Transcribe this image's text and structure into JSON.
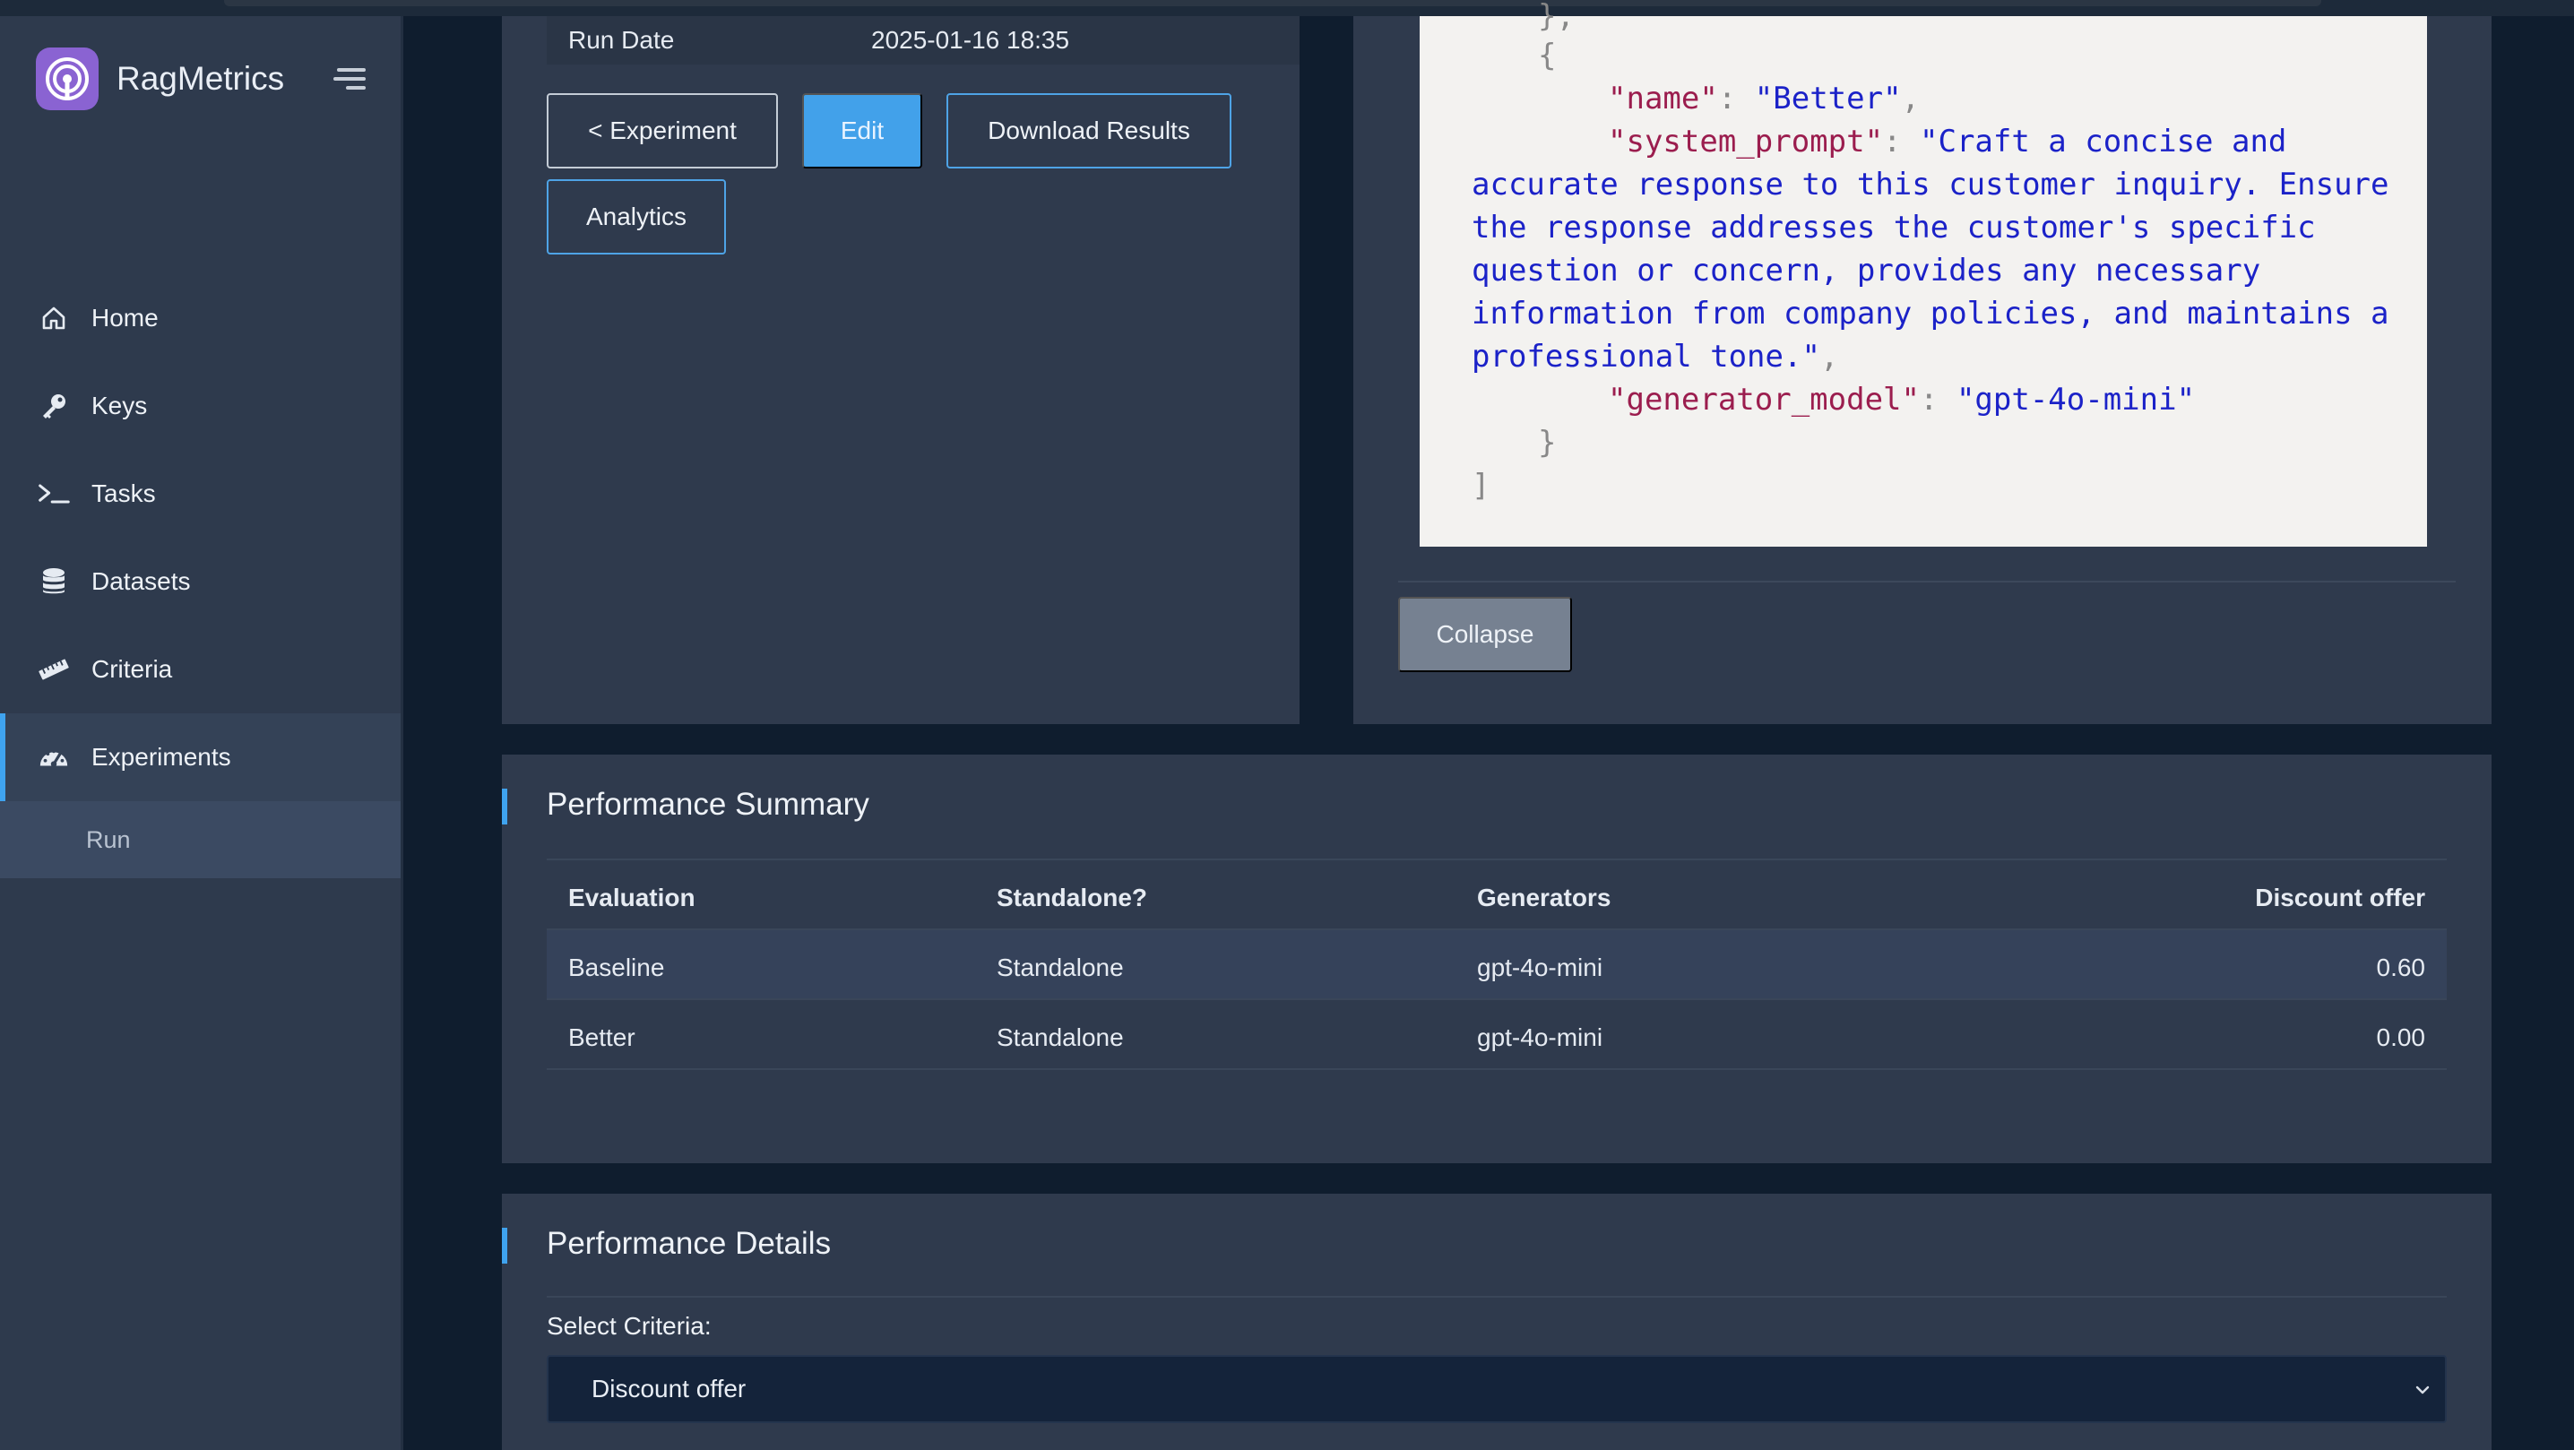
{
  "app": {
    "name": "RagMetrics"
  },
  "sidebar": {
    "items": [
      {
        "label": "Home",
        "icon": "home-icon"
      },
      {
        "label": "Keys",
        "icon": "key-icon"
      },
      {
        "label": "Tasks",
        "icon": "terminal-icon"
      },
      {
        "label": "Datasets",
        "icon": "database-icon"
      },
      {
        "label": "Criteria",
        "icon": "ruler-icon"
      },
      {
        "label": "Experiments",
        "icon": "gauge-icon",
        "active": true
      }
    ],
    "sub_items": [
      {
        "label": "Run"
      }
    ]
  },
  "run_info": {
    "run_date_label": "Run Date",
    "run_date_value": "2025-01-16 18:35"
  },
  "actions": {
    "experiment_label": "< Experiment",
    "edit_label": "Edit",
    "download_label": "Download Results",
    "analytics_label": "Analytics"
  },
  "config_code": {
    "open_brace": "{",
    "close_brace": "}",
    "close_bracket": "]",
    "name_key": "\"name\"",
    "name_value": "\"Better\"",
    "system_prompt_key": "\"system_prompt\"",
    "system_prompt_value_lines": [
      "\"Craft a concise and",
      "accurate response to this customer inquiry. Ensure",
      "the response addresses the customer's specific",
      "question or concern, provides any necessary",
      "information from company policies, and maintains a",
      "professional tone.\""
    ],
    "generator_model_key": "\"generator_model\"",
    "generator_model_value": "\"gpt-4o-mini\"",
    "collapse_label": "Collapse"
  },
  "performance_summary": {
    "title": "Performance Summary",
    "columns": [
      "Evaluation",
      "Standalone?",
      "Generators",
      "Discount offer"
    ],
    "rows": [
      [
        "Baseline",
        "Standalone",
        "gpt-4o-mini",
        "0.60"
      ],
      [
        "Better",
        "Standalone",
        "gpt-4o-mini",
        "0.00"
      ]
    ]
  },
  "performance_details": {
    "title": "Performance Details",
    "select_label": "Select Criteria:",
    "selected_criteria": "Discount offer"
  },
  "colors": {
    "accent": "#3fa3ef",
    "sidebar_bg": "#2e3a4d",
    "page_bg": "#0f1d2e",
    "logo": "#8a63d2"
  }
}
